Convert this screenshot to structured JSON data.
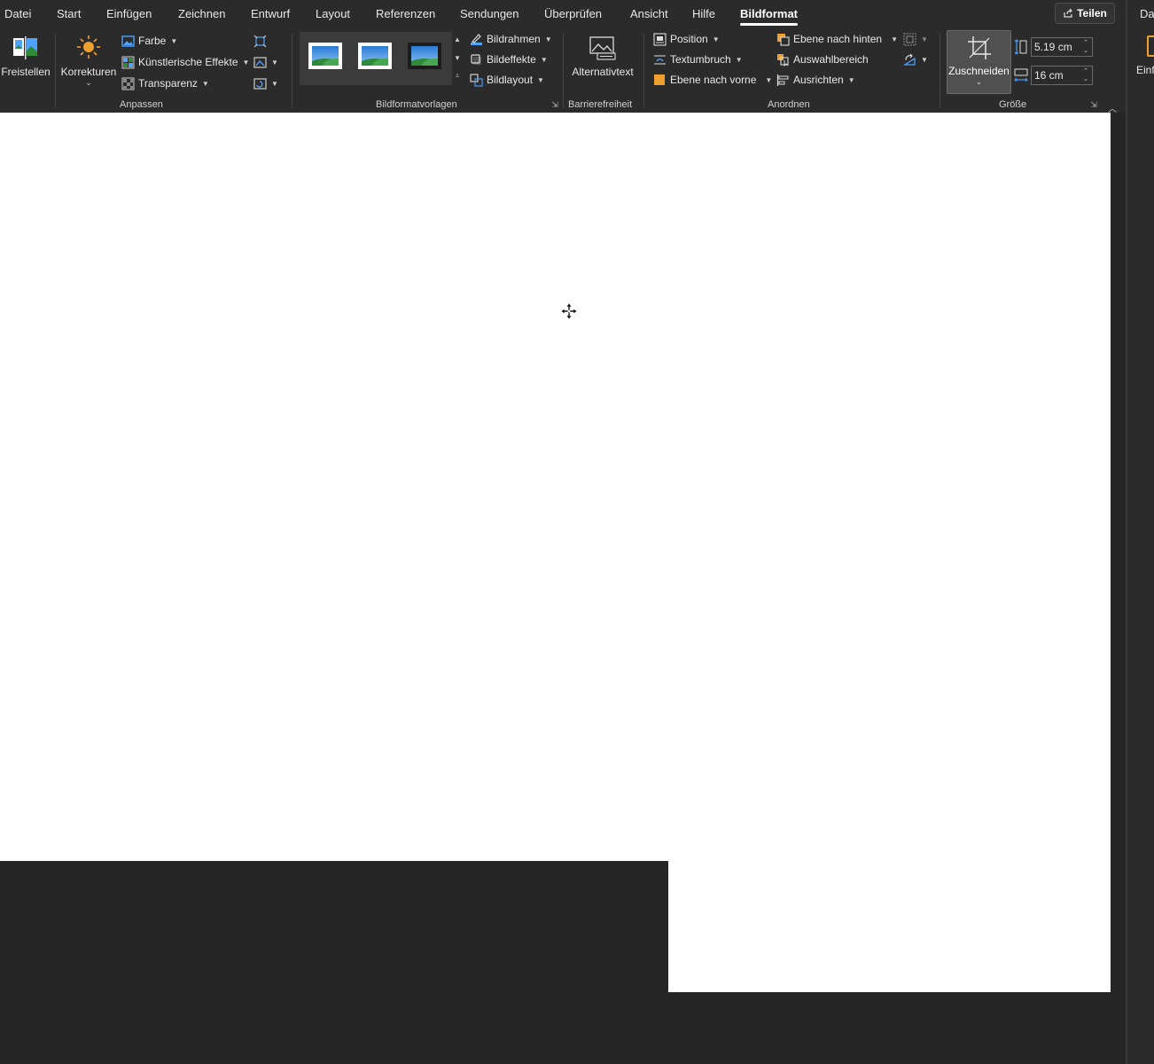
{
  "menu": {
    "items": [
      "Datei",
      "Start",
      "Einfügen",
      "Zeichnen",
      "Entwurf",
      "Layout",
      "Referenzen",
      "Sendungen",
      "Überprüfen",
      "Ansicht",
      "Hilfe",
      "Bildformat"
    ],
    "active": "Bildformat",
    "share_label": "Teilen"
  },
  "ribbon": {
    "anpassen": {
      "label": "Anpassen",
      "freistellen": "Freistellen",
      "korrekturen": "Korrekturen",
      "farbe": "Farbe",
      "kuenstlerische_effekte": "Künstlerische Effekte",
      "transparenz": "Transparenz"
    },
    "bildformatvorlagen": {
      "label": "Bildformatvorlagen",
      "bildrahmen": "Bildrahmen",
      "bildeffekte": "Bildeffekte",
      "bildlayout": "Bildlayout"
    },
    "barrierefreiheit": {
      "label": "Barrierefreiheit",
      "alternativtext": "Alternativtext"
    },
    "anordnen": {
      "label": "Anordnen",
      "position": "Position",
      "textumbruch": "Textumbruch",
      "ebene_nach_vorne": "Ebene nach vorne",
      "ebene_nach_hinten": "Ebene nach hinten",
      "auswahlbereich": "Auswahlbereich",
      "ausrichten": "Ausrichten"
    },
    "groesse": {
      "label": "Größe",
      "zuschneiden": "Zuschneiden",
      "height": "5.19 cm",
      "width": "16 cm"
    }
  },
  "side_panel": {
    "tab": "Dat",
    "button": "Einf"
  },
  "colors": {
    "accent_orange": "#f0a030",
    "icon_blue": "#4da3ff"
  }
}
